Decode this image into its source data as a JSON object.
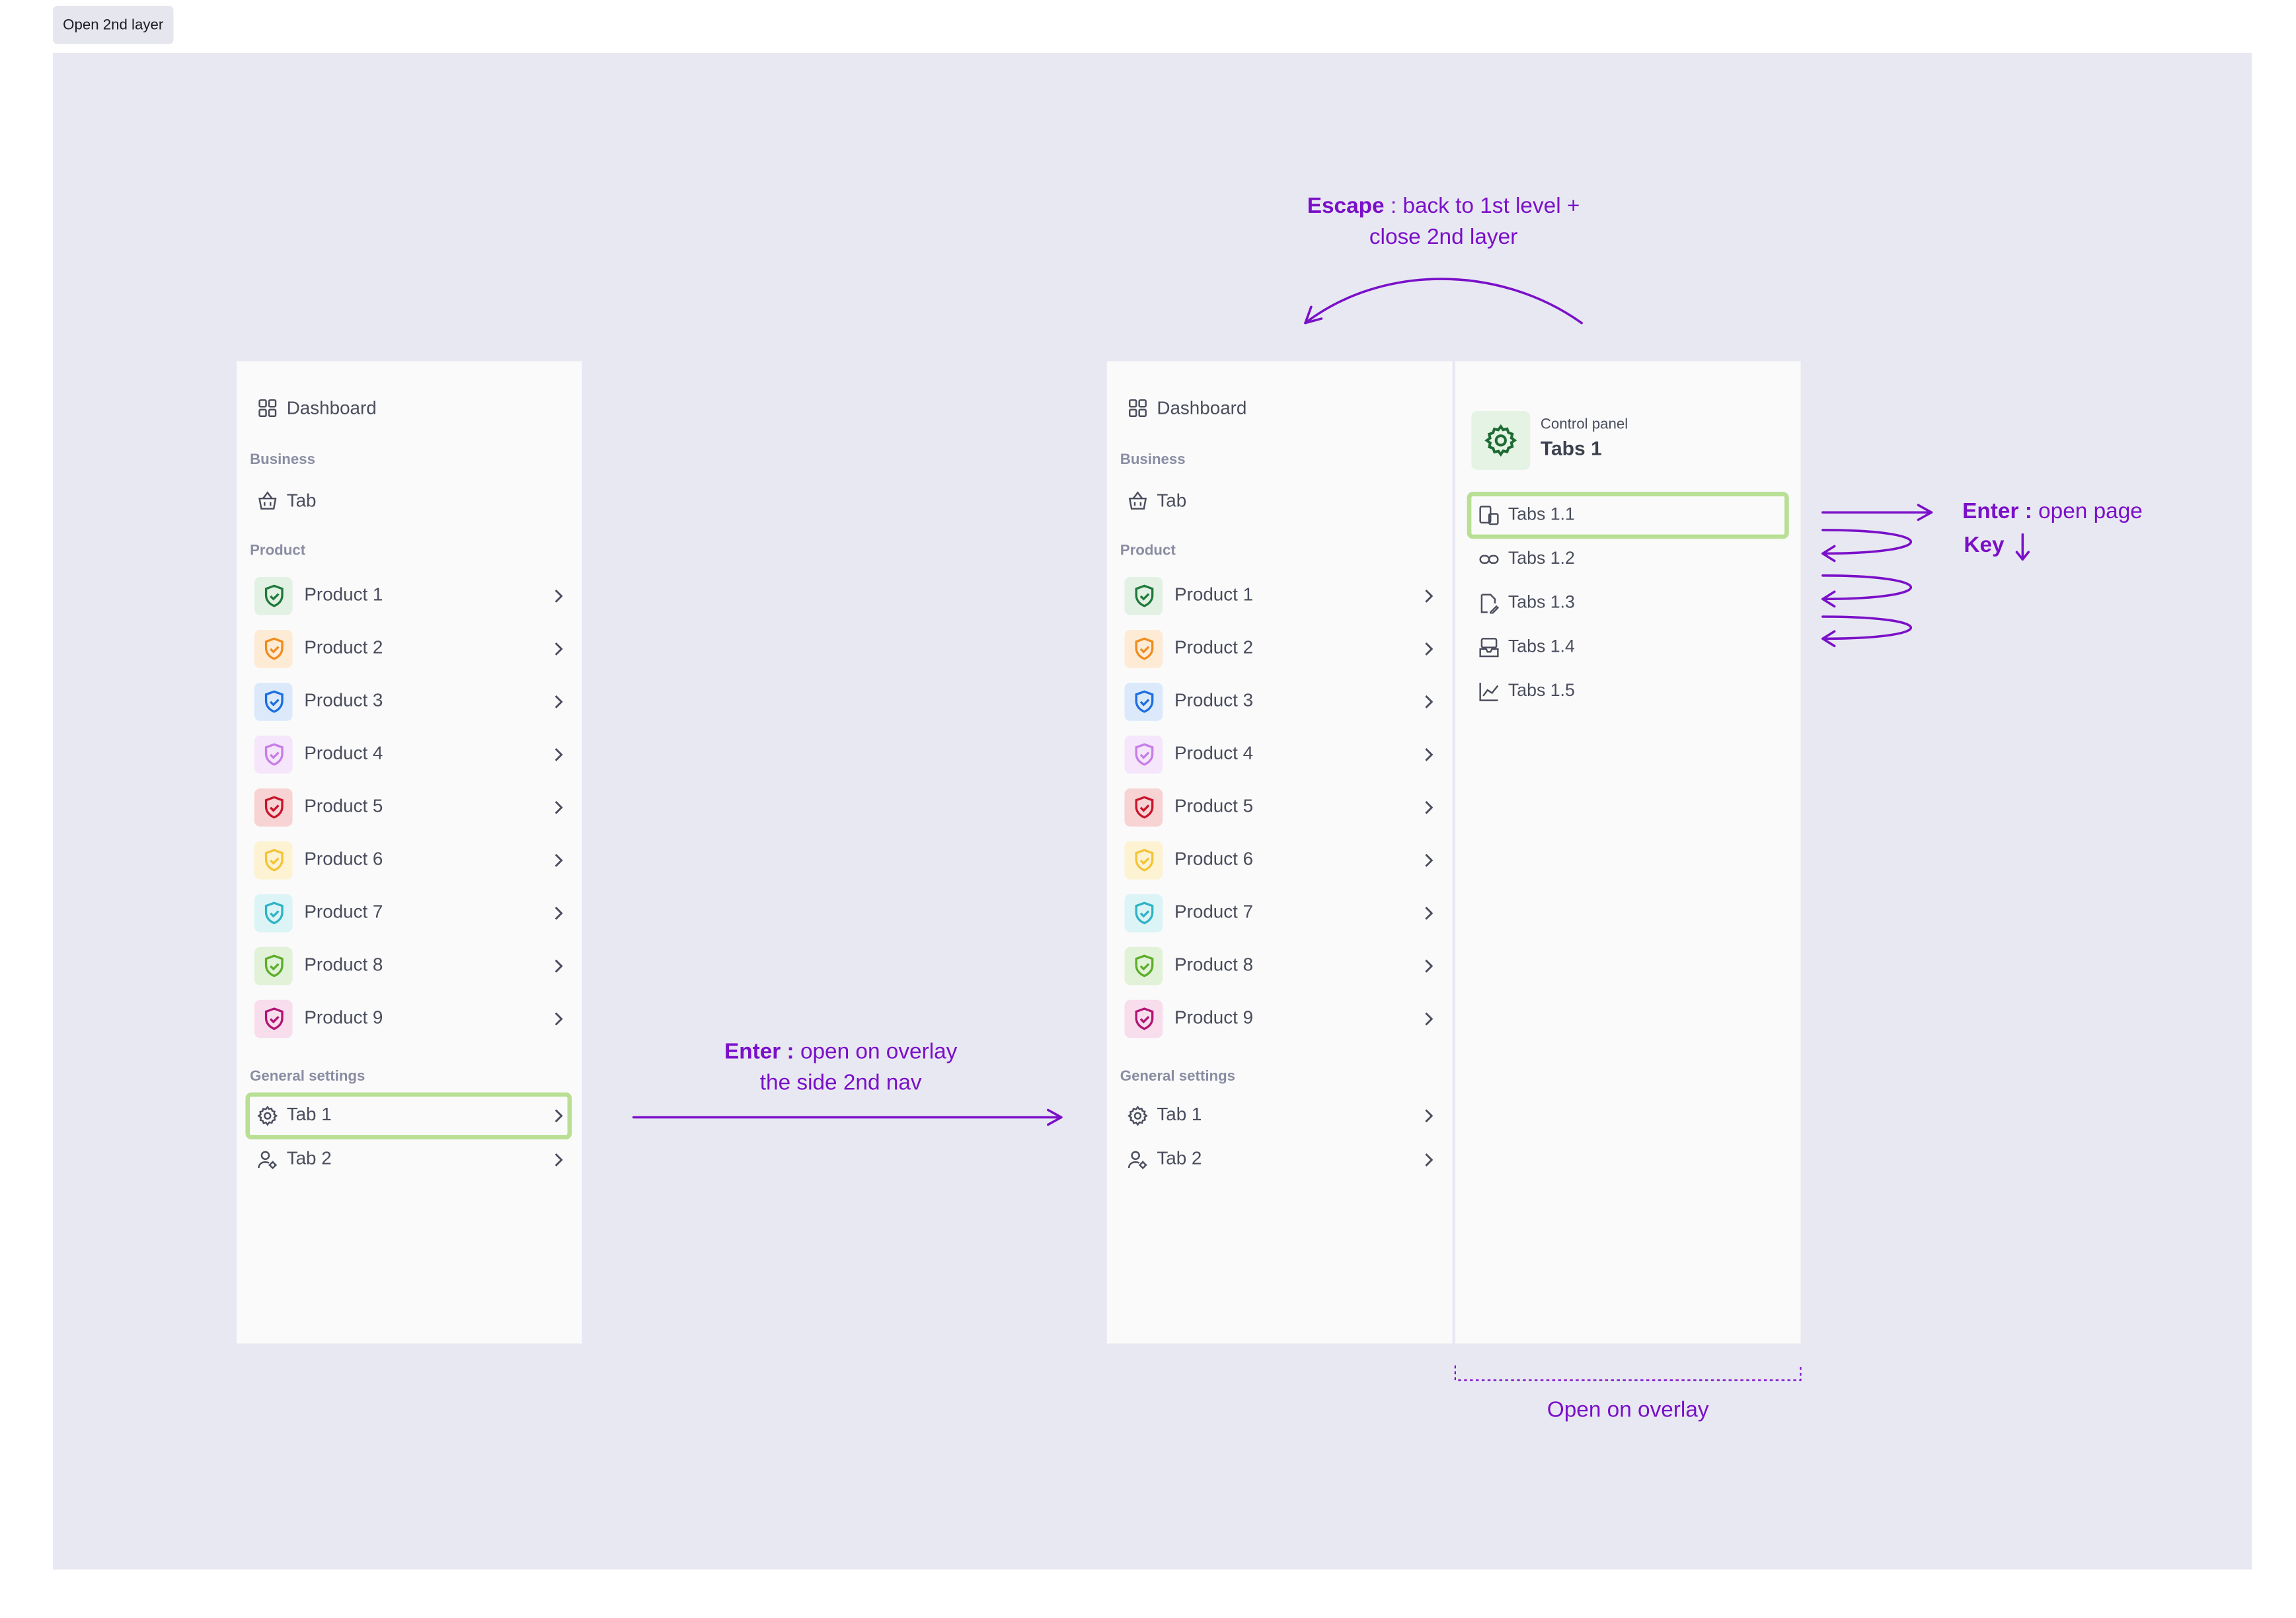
{
  "frame_tag": "Open 2nd layer",
  "nav": {
    "dashboard": "Dashboard",
    "business_header": "Business",
    "business_tab": "Tab",
    "product_header": "Product",
    "products": [
      {
        "label": "Product 1",
        "color": "#1f7a3a",
        "bg": "#e3f1e4"
      },
      {
        "label": "Product 2",
        "color": "#f08c1e",
        "bg": "#fdebd6"
      },
      {
        "label": "Product 3",
        "color": "#1c6fe0",
        "bg": "#dbe9fb"
      },
      {
        "label": "Product 4",
        "color": "#c77de8",
        "bg": "#f5e6fb"
      },
      {
        "label": "Product 5",
        "color": "#c9142b",
        "bg": "#f8d3d3"
      },
      {
        "label": "Product 6",
        "color": "#f3c437",
        "bg": "#fdf2d2"
      },
      {
        "label": "Product 7",
        "color": "#2fb3c6",
        "bg": "#dcf4f6"
      },
      {
        "label": "Product 8",
        "color": "#5cae2b",
        "bg": "#e2f2d8"
      },
      {
        "label": "Product 9",
        "color": "#b11475",
        "bg": "#f8ddec"
      }
    ],
    "general_header": "General settings",
    "tab1": "Tab 1",
    "tab2": "Tab 2"
  },
  "second_layer": {
    "subtitle": "Control panel",
    "title": "Tabs 1",
    "items": [
      "Tabs 1.1",
      "Tabs 1.2",
      "Tabs 1.3",
      "Tabs 1.4",
      "Tabs 1.5"
    ]
  },
  "annotations": {
    "escape_key": "Escape",
    "escape_line1": " : back to 1st level +",
    "escape_line2": "close 2nd layer",
    "enter_key": "Enter :",
    "enter_overlay_line1": " open on overlay",
    "enter_overlay_line2": "the side 2nd nav",
    "enter_page_key": "Enter :",
    "enter_page_text": " open page",
    "key_label": "Key",
    "open_overlay": "Open on overlay"
  },
  "colors": {
    "accent": "#7a10c8",
    "focus": "#b9df95",
    "canvas": "#e8e8f2",
    "panel": "#fafafa"
  }
}
